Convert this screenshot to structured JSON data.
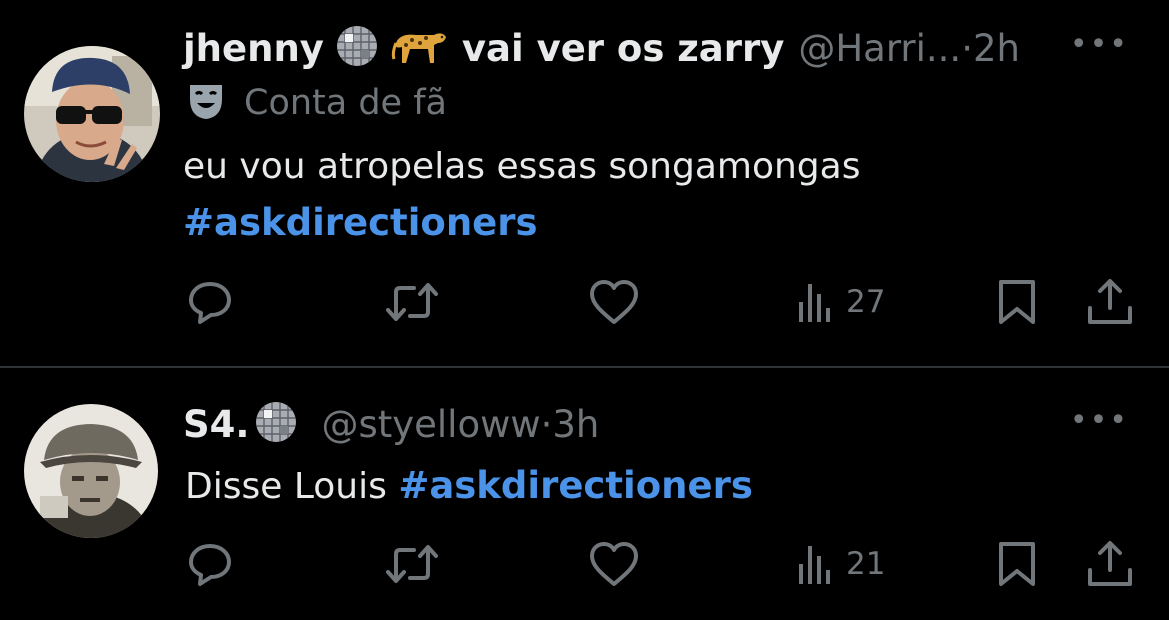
{
  "tweets": [
    {
      "display_name": "jhenny",
      "display_name_suffix": "vai ver os zarry",
      "emojis": [
        "disco-ball-icon",
        "leopard-icon"
      ],
      "handle": "@Harri...",
      "separator": "·",
      "time": "2h",
      "badge": "Conta de fã",
      "text": "eu vou atropelas essas songamongas",
      "hashtag": "#askdirectioners",
      "views": "27"
    },
    {
      "display_name": "S4.",
      "emojis": [
        "disco-ball-icon"
      ],
      "handle": "@styelloww",
      "separator": "·",
      "time": "3h",
      "text": "Disse Louis",
      "hashtag": "#askdirectioners",
      "views": "21"
    }
  ],
  "more_label": "•••",
  "colors": {
    "background": "#000000",
    "text": "#e7e9ea",
    "muted": "#71767b",
    "link": "#4a93e8",
    "divider": "#2f3336"
  }
}
